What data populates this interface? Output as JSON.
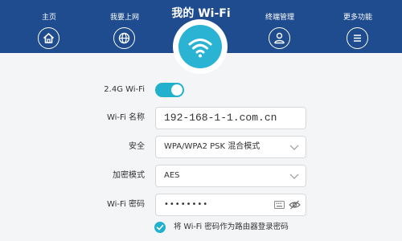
{
  "header": {
    "title": "我的 Wi-Fi",
    "nav": [
      {
        "label": "主页",
        "icon": "home-icon"
      },
      {
        "label": "我要上网",
        "icon": "globe-icon"
      },
      {
        "label": "终端管理",
        "icon": "user-icon"
      },
      {
        "label": "更多功能",
        "icon": "menu-icon"
      }
    ],
    "center_icon": "wifi-icon"
  },
  "form": {
    "wifi24_label": "2.4G Wi-Fi",
    "wifi24_enabled": true,
    "name_label": "Wi-Fi 名称",
    "name_value": "192-168-1-1.com.cn",
    "security_label": "安全",
    "security_value": "WPA/WPA2 PSK 混合模式",
    "encryption_label": "加密模式",
    "encryption_value": "AES",
    "password_label": "Wi-Fi 密码",
    "password_value": "••••••••",
    "use_as_router_password_label": "将 Wi-Fi 密码作为路由器登录密码",
    "use_as_router_password_checked": true
  },
  "colors": {
    "header_bg": "#1f4c8e",
    "accent": "#22b0cf",
    "background": "#f4f5f6"
  }
}
